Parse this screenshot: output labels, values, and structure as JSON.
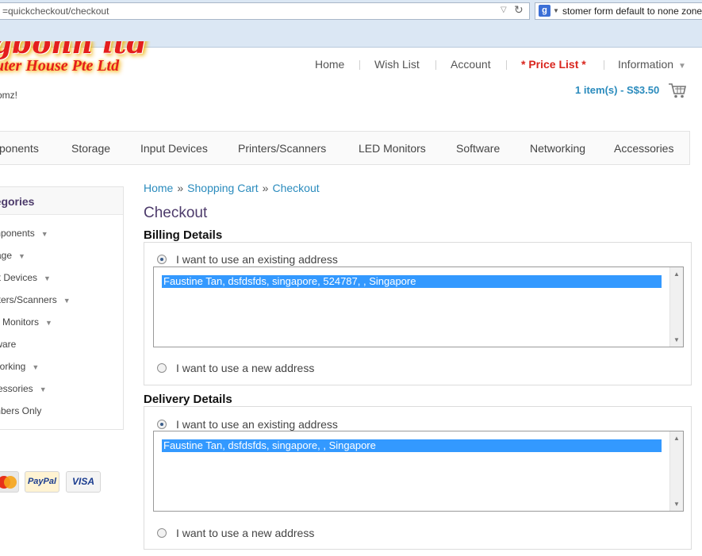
{
  "browser": {
    "url": "=quickcheckout/checkout",
    "search_text": "stomer form default to none zone",
    "search_engine_icon": "g"
  },
  "logo": {
    "top": "gbonn ltd",
    "sub": "puter House Pte Ltd"
  },
  "welcome": "omz!",
  "toplinks": {
    "home": "Home",
    "wishlist": "Wish List",
    "account": "Account",
    "pricelist": "* Price List *",
    "information": "Information"
  },
  "cart": {
    "summary": "1 item(s) - S$3.50"
  },
  "menu": [
    "ponents",
    "Storage",
    "Input Devices",
    "Printers/Scanners",
    "LED Monitors",
    "Software",
    "Networking",
    "Accessories"
  ],
  "sidebar": {
    "heading": "tegories",
    "items": [
      {
        "label": "mponents",
        "arrow": "▼"
      },
      {
        "label": "rage",
        "arrow": "▼"
      },
      {
        "label": "ut Devices",
        "arrow": "▼"
      },
      {
        "label": "nters/Scanners",
        "arrow": "▼"
      },
      {
        "label": "D Monitors",
        "arrow": "▼"
      },
      {
        "label": "tware",
        "arrow": ""
      },
      {
        "label": "working",
        "arrow": "▼"
      },
      {
        "label": "cessories",
        "arrow": "▼"
      },
      {
        "label": "mbers Only",
        "arrow": ""
      }
    ]
  },
  "payments": {
    "mastercard": "MasterCard",
    "paypal": "PayPal",
    "visa": "VISA"
  },
  "breadcrumb": {
    "home": "Home",
    "cart": "Shopping Cart",
    "checkout": "Checkout",
    "separator": "»"
  },
  "page_title": "Checkout",
  "billing": {
    "title": "Billing Details",
    "existing_label": "I want to use an existing address",
    "selected_address": "Faustine Tan, dsfdsfds, singapore, 524787, , Singapore",
    "new_label": "I want to use a new address"
  },
  "delivery": {
    "title": "Delivery Details",
    "existing_label": "I want to use an existing address",
    "selected_address": "Faustine Tan, dsfdsfds, singapore, , Singapore",
    "new_label": "I want to use a new address"
  }
}
